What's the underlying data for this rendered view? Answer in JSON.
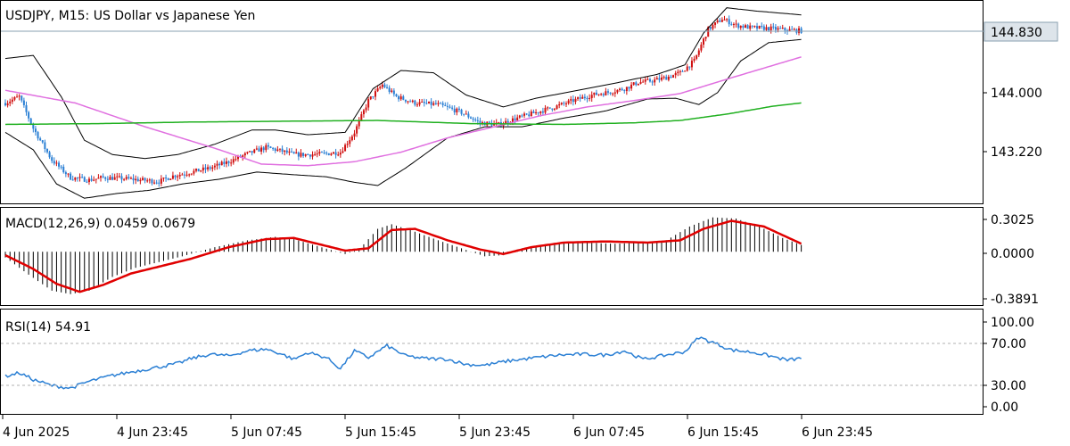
{
  "chart_data": [
    {
      "type": "candlestick",
      "title": "USDJPY, M15:  US Dollar vs Japanese Yen",
      "current_price": "144.830",
      "y_ticks": [
        "144.000",
        "143.220"
      ],
      "ylim": [
        142.7,
        145.15
      ],
      "colors": {
        "up": "#d01010",
        "down": "#2a7fd4",
        "bollinger": "#000000",
        "ma_fast": "#e070e0",
        "ma_slow": "#20b020",
        "price_line": "#8aa0b0"
      },
      "price_path": [
        [
          0,
          143.92
        ],
        [
          6,
          144.0
        ],
        [
          12,
          143.6
        ],
        [
          20,
          143.2
        ],
        [
          28,
          142.98
        ],
        [
          36,
          142.95
        ],
        [
          42,
          142.98
        ],
        [
          50,
          142.97
        ],
        [
          58,
          142.95
        ],
        [
          66,
          142.93
        ],
        [
          72,
          143.0
        ],
        [
          80,
          143.05
        ],
        [
          88,
          143.1
        ],
        [
          96,
          143.18
        ],
        [
          104,
          143.28
        ],
        [
          112,
          143.36
        ],
        [
          118,
          143.32
        ],
        [
          124,
          143.27
        ],
        [
          130,
          143.27
        ],
        [
          137,
          143.28
        ],
        [
          144,
          143.3
        ],
        [
          150,
          143.55
        ],
        [
          156,
          143.95
        ],
        [
          162,
          144.15
        ],
        [
          168,
          144.0
        ],
        [
          176,
          143.92
        ],
        [
          186,
          143.9
        ],
        [
          196,
          143.8
        ],
        [
          204,
          143.67
        ],
        [
          212,
          143.65
        ],
        [
          220,
          143.73
        ],
        [
          228,
          143.8
        ],
        [
          236,
          143.87
        ],
        [
          244,
          143.95
        ],
        [
          252,
          144.02
        ],
        [
          260,
          144.06
        ],
        [
          266,
          144.1
        ],
        [
          272,
          144.18
        ],
        [
          278,
          144.2
        ],
        [
          284,
          144.24
        ],
        [
          290,
          144.3
        ],
        [
          296,
          144.45
        ],
        [
          302,
          144.85
        ],
        [
          308,
          144.98
        ],
        [
          314,
          144.9
        ],
        [
          320,
          144.87
        ],
        [
          328,
          144.86
        ],
        [
          336,
          144.84
        ],
        [
          342,
          144.83
        ]
      ],
      "bollinger": {
        "upper": [
          [
            0,
            144.48
          ],
          [
            12,
            144.52
          ],
          [
            24,
            144.0
          ],
          [
            34,
            143.45
          ],
          [
            46,
            143.27
          ],
          [
            60,
            143.22
          ],
          [
            74,
            143.27
          ],
          [
            90,
            143.4
          ],
          [
            106,
            143.58
          ],
          [
            116,
            143.58
          ],
          [
            130,
            143.52
          ],
          [
            146,
            143.55
          ],
          [
            158,
            144.1
          ],
          [
            170,
            144.33
          ],
          [
            184,
            144.3
          ],
          [
            198,
            144.02
          ],
          [
            214,
            143.87
          ],
          [
            228,
            143.98
          ],
          [
            246,
            144.08
          ],
          [
            262,
            144.17
          ],
          [
            280,
            144.28
          ],
          [
            292,
            144.4
          ],
          [
            300,
            144.8
          ],
          [
            310,
            145.12
          ],
          [
            322,
            145.08
          ],
          [
            334,
            145.05
          ],
          [
            342,
            145.03
          ]
        ],
        "lower": [
          [
            0,
            143.55
          ],
          [
            12,
            143.33
          ],
          [
            22,
            142.9
          ],
          [
            34,
            142.72
          ],
          [
            48,
            142.78
          ],
          [
            62,
            142.82
          ],
          [
            76,
            142.9
          ],
          [
            92,
            142.96
          ],
          [
            108,
            143.05
          ],
          [
            122,
            143.02
          ],
          [
            138,
            142.99
          ],
          [
            150,
            142.92
          ],
          [
            160,
            142.88
          ],
          [
            172,
            143.1
          ],
          [
            190,
            143.48
          ],
          [
            206,
            143.62
          ],
          [
            222,
            143.62
          ],
          [
            240,
            143.73
          ],
          [
            258,
            143.82
          ],
          [
            276,
            143.97
          ],
          [
            288,
            143.98
          ],
          [
            298,
            143.9
          ],
          [
            306,
            144.05
          ],
          [
            316,
            144.45
          ],
          [
            328,
            144.68
          ],
          [
            342,
            144.72
          ]
        ]
      },
      "ma_fast": [
        [
          0,
          144.08
        ],
        [
          30,
          143.92
        ],
        [
          60,
          143.62
        ],
        [
          90,
          143.35
        ],
        [
          110,
          143.15
        ],
        [
          130,
          143.13
        ],
        [
          150,
          143.18
        ],
        [
          170,
          143.3
        ],
        [
          190,
          143.48
        ],
        [
          210,
          143.62
        ],
        [
          230,
          143.76
        ],
        [
          250,
          143.87
        ],
        [
          270,
          143.95
        ],
        [
          290,
          144.04
        ],
        [
          310,
          144.22
        ],
        [
          342,
          144.5
        ]
      ],
      "ma_slow": [
        [
          0,
          143.65
        ],
        [
          40,
          143.66
        ],
        [
          80,
          143.68
        ],
        [
          120,
          143.69
        ],
        [
          160,
          143.7
        ],
        [
          200,
          143.66
        ],
        [
          240,
          143.65
        ],
        [
          270,
          143.67
        ],
        [
          290,
          143.7
        ],
        [
          310,
          143.78
        ],
        [
          330,
          143.88
        ],
        [
          342,
          143.92
        ]
      ]
    },
    {
      "type": "histogram+line",
      "label": "MACD(12,26,9) 0.0459 0.0679",
      "y_ticks": [
        "0.3025",
        "0.0000",
        "-0.3891"
      ],
      "ylim": [
        -0.45,
        0.36
      ],
      "histogram": [
        [
          0,
          -0.05
        ],
        [
          10,
          -0.2
        ],
        [
          20,
          -0.34
        ],
        [
          28,
          -0.37
        ],
        [
          36,
          -0.34
        ],
        [
          46,
          -0.22
        ],
        [
          56,
          -0.14
        ],
        [
          66,
          -0.09
        ],
        [
          76,
          -0.04
        ],
        [
          90,
          0.04
        ],
        [
          104,
          0.1
        ],
        [
          116,
          0.13
        ],
        [
          124,
          0.11
        ],
        [
          134,
          0.05
        ],
        [
          146,
          -0.02
        ],
        [
          152,
          0.02
        ],
        [
          160,
          0.2
        ],
        [
          166,
          0.24
        ],
        [
          174,
          0.19
        ],
        [
          186,
          0.1
        ],
        [
          196,
          0.03
        ],
        [
          206,
          -0.04
        ],
        [
          214,
          -0.03
        ],
        [
          222,
          0.03
        ],
        [
          234,
          0.07
        ],
        [
          248,
          0.08
        ],
        [
          262,
          0.07
        ],
        [
          274,
          0.08
        ],
        [
          284,
          0.1
        ],
        [
          294,
          0.22
        ],
        [
          304,
          0.3
        ],
        [
          314,
          0.29
        ],
        [
          324,
          0.22
        ],
        [
          334,
          0.12
        ],
        [
          342,
          0.06
        ]
      ],
      "signal": [
        [
          0,
          -0.03
        ],
        [
          12,
          -0.15
        ],
        [
          22,
          -0.28
        ],
        [
          32,
          -0.35
        ],
        [
          42,
          -0.29
        ],
        [
          54,
          -0.19
        ],
        [
          66,
          -0.13
        ],
        [
          80,
          -0.06
        ],
        [
          96,
          0.04
        ],
        [
          112,
          0.11
        ],
        [
          124,
          0.12
        ],
        [
          134,
          0.07
        ],
        [
          146,
          0.01
        ],
        [
          156,
          0.03
        ],
        [
          166,
          0.19
        ],
        [
          176,
          0.2
        ],
        [
          190,
          0.1
        ],
        [
          204,
          0.02
        ],
        [
          214,
          -0.02
        ],
        [
          226,
          0.04
        ],
        [
          240,
          0.08
        ],
        [
          258,
          0.09
        ],
        [
          276,
          0.08
        ],
        [
          290,
          0.1
        ],
        [
          300,
          0.2
        ],
        [
          312,
          0.27
        ],
        [
          326,
          0.22
        ],
        [
          342,
          0.07
        ]
      ]
    },
    {
      "type": "line",
      "label": "RSI(14) 54.91",
      "y_ticks": [
        "100.00",
        "70.00",
        "30.00",
        "0.00"
      ],
      "ylim": [
        0,
        100
      ],
      "levels": [
        70,
        30
      ],
      "values": [
        [
          0,
          36
        ],
        [
          6,
          40
        ],
        [
          12,
          32
        ],
        [
          20,
          25
        ],
        [
          28,
          22
        ],
        [
          36,
          30
        ],
        [
          46,
          37
        ],
        [
          56,
          42
        ],
        [
          66,
          47
        ],
        [
          74,
          51
        ],
        [
          80,
          57
        ],
        [
          88,
          62
        ],
        [
          96,
          60
        ],
        [
          104,
          66
        ],
        [
          112,
          68
        ],
        [
          118,
          63
        ],
        [
          124,
          56
        ],
        [
          130,
          64
        ],
        [
          138,
          58
        ],
        [
          144,
          45
        ],
        [
          150,
          66
        ],
        [
          156,
          58
        ],
        [
          164,
          72
        ],
        [
          172,
          60
        ],
        [
          180,
          57
        ],
        [
          190,
          56
        ],
        [
          198,
          50
        ],
        [
          206,
          49
        ],
        [
          216,
          54
        ],
        [
          228,
          58
        ],
        [
          238,
          61
        ],
        [
          248,
          62
        ],
        [
          258,
          61
        ],
        [
          266,
          66
        ],
        [
          274,
          56
        ],
        [
          284,
          61
        ],
        [
          292,
          65
        ],
        [
          298,
          82
        ],
        [
          304,
          76
        ],
        [
          312,
          67
        ],
        [
          322,
          64
        ],
        [
          330,
          59
        ],
        [
          336,
          55
        ],
        [
          342,
          57
        ]
      ]
    }
  ],
  "x_axis": {
    "ticks": [
      "4 Jun 2025",
      "4 Jun 23:45",
      "5 Jun 07:45",
      "5 Jun 15:45",
      "5 Jun 23:45",
      "6 Jun 07:45",
      "6 Jun 15:45",
      "6 Jun 23:45"
    ]
  }
}
